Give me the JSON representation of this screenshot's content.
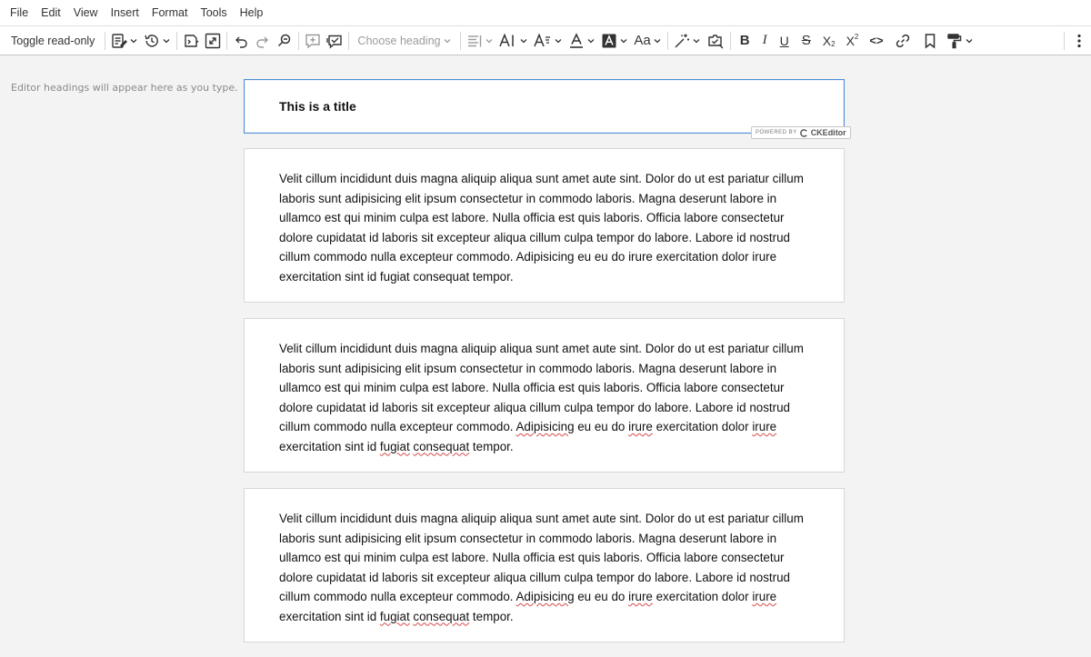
{
  "menubar": {
    "items": [
      "File",
      "Edit",
      "View",
      "Insert",
      "Format",
      "Tools",
      "Help"
    ]
  },
  "toolbar": {
    "toggle_readonly_label": "Toggle read-only",
    "heading_placeholder": "Choose heading",
    "subscript_label": "X",
    "superscript_label": "X",
    "bold_label": "B",
    "italic_label": "I",
    "underline_label": "U",
    "strike_label": "S",
    "source_label": "<>",
    "font_size_label": "AI",
    "font_family_label": "A",
    "case_label": "Aa"
  },
  "outline": {
    "hint": "Editor headings will appear here as you type."
  },
  "editor": {
    "title": "This is a title",
    "powered_by": "POWERED BY",
    "brand": "CKEditor",
    "paragraphs": [
      {
        "p1": "Velit cillum incididunt duis magna aliquip aliqua sunt amet aute sint. Dolor do ut est pariatur cillum laboris sunt adipisicing elit ipsum consectetur in commodo laboris. Magna deserunt labore in ullamco est qui minim culpa est labore. Nulla officia est quis laboris. Officia labore consectetur dolore cupidatat id laboris sit excepteur aliqua cillum culpa tempor do labore. Labore id nostrud cillum commodo nulla excepteur commodo. Adipisicing eu eu do irure exercitation dolor irure exercitation sint id fugiat consequat tempor."
      },
      {
        "a": "Velit cillum incididunt duis magna aliquip aliqua sunt amet aute sint. Dolor do ut est pariatur cillum laboris sunt adipisicing elit ipsum consectetur in commodo laboris. Magna deserunt labore in ullamco est qui minim culpa est labore. Nulla officia est quis laboris. Officia labore consectetur dolore cupidatat id laboris sit excepteur aliqua cillum culpa tempor do labore. Labore id nostrud cillum commodo nulla excepteur commodo. ",
        "w1": "Adipisicing",
        "b": " eu eu do ",
        "w2": "irure",
        "c": " exercitation dolor ",
        "w3": "irure",
        "d": " exercitation sint id ",
        "w4": "fugiat",
        "e": " ",
        "w5": "consequat",
        "f": " tempor."
      },
      {
        "a": "Velit cillum incididunt duis magna aliquip aliqua sunt amet aute sint. Dolor do ut est pariatur cillum laboris sunt adipisicing elit ipsum consectetur in commodo laboris. Magna deserunt labore in ullamco est qui minim culpa est labore. Nulla officia est quis laboris. Officia labore consectetur dolore cupidatat id laboris sit excepteur aliqua cillum culpa tempor do labore. Labore id nostrud cillum commodo nulla excepteur commodo. ",
        "w1": "Adipisicing",
        "b": " eu eu do ",
        "w2": "irure",
        "c": " exercitation dolor ",
        "w3": "irure",
        "d": " exercitation sint id ",
        "w4": "fugiat",
        "e": " ",
        "w5": "consequat",
        "f": " tempor."
      }
    ]
  },
  "colors": {
    "accent": "#4d8fd6",
    "spellcheck": "#d64a4a"
  }
}
